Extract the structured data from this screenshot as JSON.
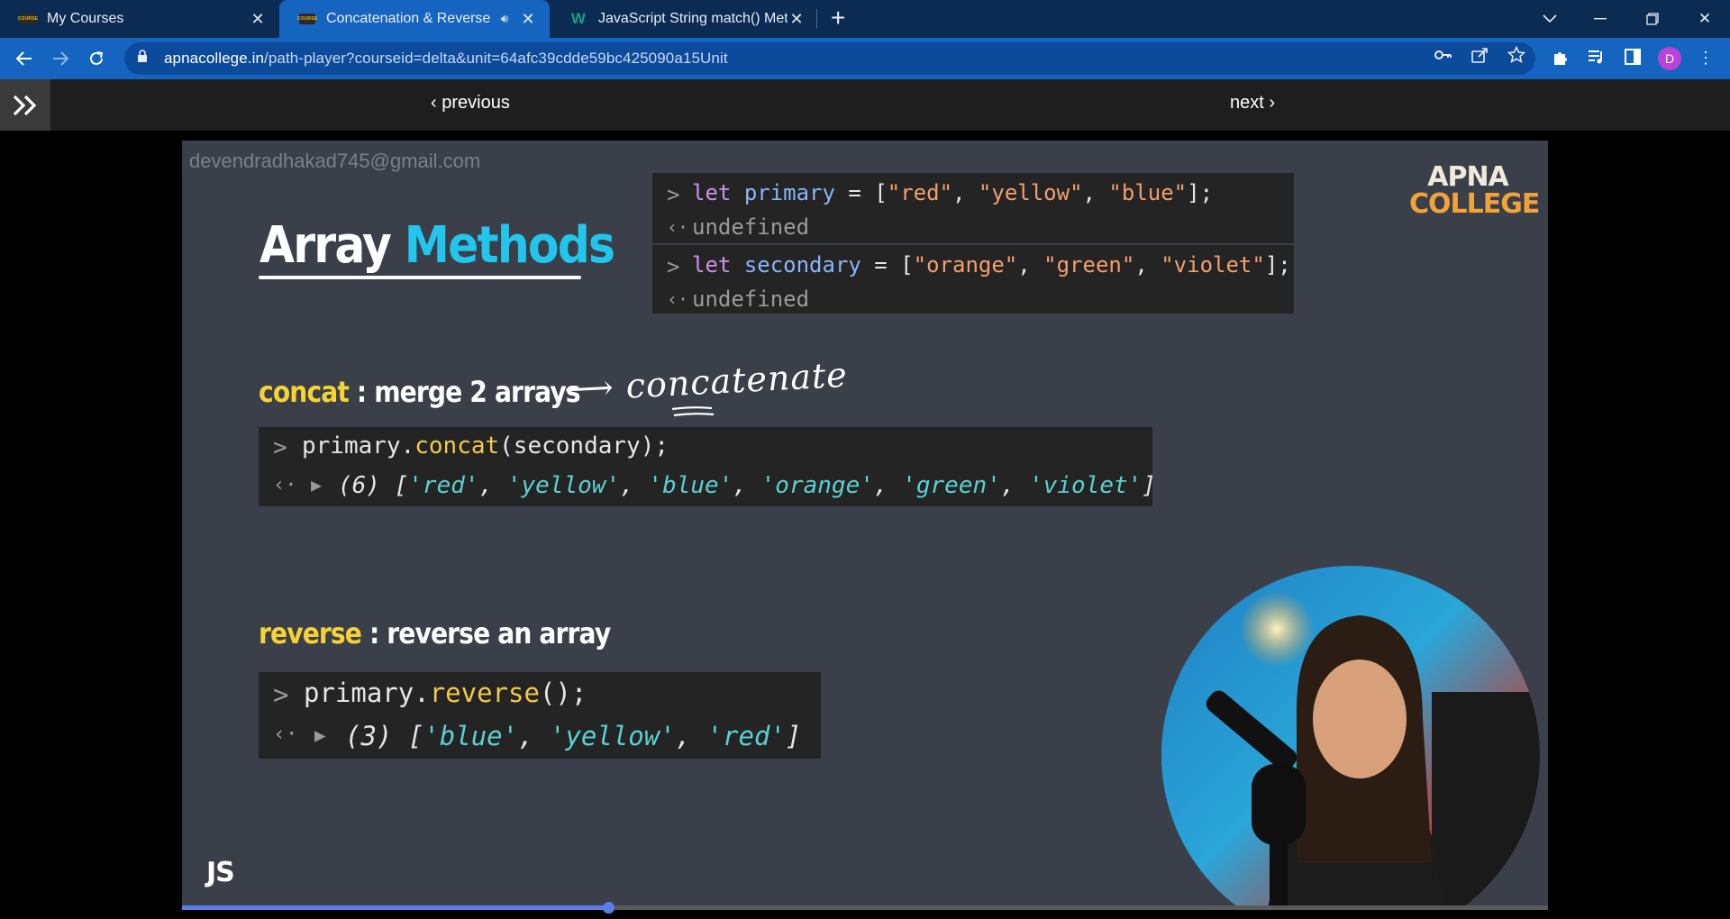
{
  "tabs": [
    {
      "title": "My Courses",
      "favicon": "apna-college-favicon"
    },
    {
      "title": "Concatenation & Reverse",
      "favicon": "apna-college-favicon",
      "active": true,
      "audio": true
    },
    {
      "title": "JavaScript String match() Method",
      "favicon": "w3schools-favicon"
    }
  ],
  "address": {
    "domain": "apnacollege.in",
    "path": "/path-player?courseid=delta&unit=64afc39cdde59bc425090a15Unit"
  },
  "profile": {
    "initial": "D",
    "color": "#b843d6"
  },
  "player": {
    "previous": "previous",
    "next": "next"
  },
  "slide": {
    "watermark": "devendradhakad745@gmail.com",
    "title_part1": "Array",
    "title_part2": "Methods",
    "brand_line1": "APNA",
    "brand_line2": "COLLEGE",
    "console_top": {
      "line1": {
        "kw": "let",
        "var": "primary",
        "rest": " = [",
        "s1": "\"red\"",
        "c1": ", ",
        "s2": "\"yellow\"",
        "c2": ", ",
        "s3": "\"blue\"",
        "end": "];"
      },
      "result1": "undefined",
      "line2": {
        "kw": "let",
        "var": "secondary",
        "rest": " = [",
        "s1": "\"orange\"",
        "c1": ", ",
        "s2": "\"green\"",
        "c2": ", ",
        "s3": "\"violet\"",
        "end": "];"
      },
      "result2": "undefined"
    },
    "concat": {
      "keyword": "concat",
      "description": " : merge 2 arrays",
      "handwritten": "⟶ concatenate",
      "code_obj": "primary.",
      "code_method": "concat",
      "code_args": "(secondary);",
      "result_count": "(6)",
      "result_items": [
        "'red'",
        "'yellow'",
        "'blue'",
        "'orange'",
        "'green'",
        "'violet'"
      ]
    },
    "reverse": {
      "keyword": "reverse",
      "description": " : reverse an array",
      "code_obj": "primary.",
      "code_method": "reverse",
      "code_args": "();",
      "result_count": "(3)",
      "result_items": [
        "'blue'",
        "'yellow'",
        "'red'"
      ]
    },
    "footer_label": "JS"
  },
  "video_progress": 0.312
}
